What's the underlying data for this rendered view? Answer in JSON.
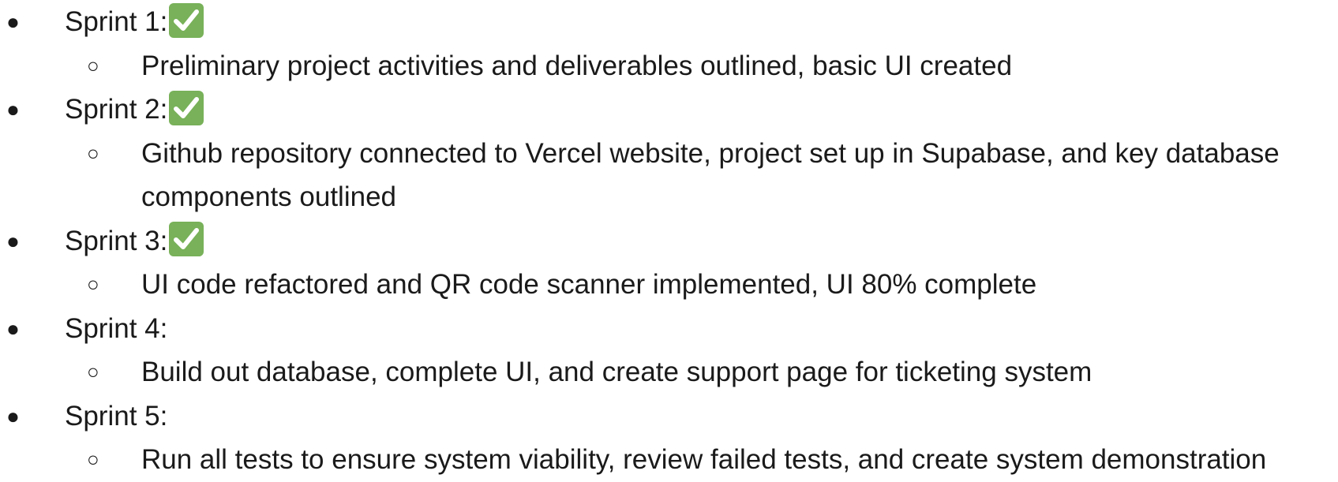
{
  "sprints": [
    {
      "label": "Sprint 1:",
      "done": true,
      "check_icon": "white-check-mark-icon",
      "details": [
        "Preliminary project activities and deliverables outlined, basic UI created"
      ]
    },
    {
      "label": "Sprint 2:",
      "done": true,
      "check_icon": "white-check-mark-icon",
      "details": [
        "Github repository connected to Vercel website, project set up in Supabase, and key database",
        "components outlined"
      ]
    },
    {
      "label": "Sprint 3:",
      "done": true,
      "check_icon": "white-check-mark-icon",
      "details": [
        "UI code refactored and QR code scanner implemented, UI 80% complete"
      ]
    },
    {
      "label": "Sprint 4:",
      "done": false,
      "details": [
        "Build out database, complete UI, and create support page for ticketing system"
      ]
    },
    {
      "label": "Sprint 5:",
      "done": false,
      "details": [
        "Run all tests to ensure system viability, review failed tests, and create system demonstration"
      ]
    }
  ],
  "bullets": {
    "primary": "●",
    "secondary": "○"
  },
  "colors": {
    "text": "#1a1a1a",
    "check_background": "#78b159",
    "check_mark": "#ffffff"
  }
}
